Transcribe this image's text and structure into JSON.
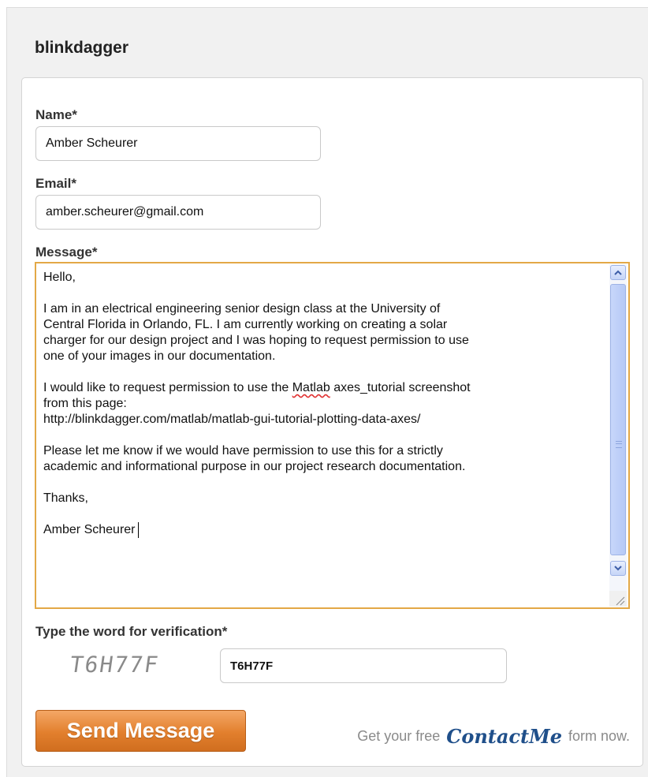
{
  "site": {
    "title": "blinkdagger"
  },
  "form": {
    "name_label": "Name*",
    "name_value": "Amber Scheurer",
    "email_label": "Email*",
    "email_value": "amber.scheurer@gmail.com",
    "message_label": "Message*",
    "message": {
      "greeting": "Hello,",
      "para1": "I am in an electrical engineering senior design class at the University of\nCentral Florida in Orlando, FL. I am currently working on creating a solar\ncharger for our design project and I was hoping to request permission to use\none of your images in our documentation.",
      "para2_before": "I would like to request permission to use the ",
      "para2_misspelled": "Matlab",
      "para2_after": " axes_tutorial screenshot\nfrom this page:\nhttp://blinkdagger.com/matlab/matlab-gui-tutorial-plotting-data-axes/",
      "para3": "Please let me know if we would have permission to use this for a strictly\nacademic and informational purpose in our project research documentation.",
      "closing": "Thanks,",
      "signature": "Amber Scheurer"
    },
    "verification_label": "Type the word for verification*",
    "captcha_text": "T6H77F",
    "captcha_value": "T6H77F",
    "send_label": "Send Message"
  },
  "footer": {
    "prefix": "Get your free",
    "brand": "ContactMe",
    "suffix": "form now."
  },
  "colors": {
    "accent_orange": "#e27f2d",
    "focus_border": "#e3a846",
    "scrollbar_blue": "#b6c9f6"
  }
}
